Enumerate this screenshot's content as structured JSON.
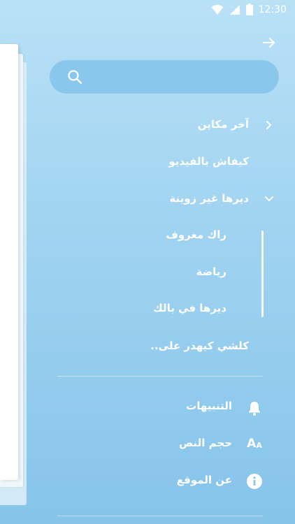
{
  "status_bar": {
    "time": "12:30",
    "icons": [
      "wifi-icon",
      "signal-icon",
      "battery-icon"
    ]
  },
  "header": {
    "arrow_icon": "arrow-right-icon"
  },
  "search": {
    "placeholder": "",
    "value": "",
    "icon": "search-icon"
  },
  "menu": {
    "items": [
      {
        "label": "آخر مكاين",
        "icon": "chevron-right-icon"
      },
      {
        "label": "كيفاش بالفيديو"
      },
      {
        "label": "ديرها غير زوينة",
        "icon": "chevron-down-icon",
        "children": [
          {
            "label": "راك معروف"
          },
          {
            "label": "رياضة"
          },
          {
            "label": "ديرها في بالك"
          }
        ]
      },
      {
        "label": "كلشي كيهدر على.."
      }
    ]
  },
  "settings": {
    "items": [
      {
        "label": "التنبيهات",
        "icon": "bell-icon"
      },
      {
        "label": "حجم النص",
        "icon": "text-size-icon",
        "icon_text": "A",
        "icon_text_small": "A"
      },
      {
        "label": "عن الموقع",
        "icon": "info-icon"
      }
    ]
  },
  "colors": {
    "background_top": "#b9e1f6",
    "background_bottom": "#86c4ea",
    "search_fill": "#8ac7ec",
    "text": "#ffffff"
  }
}
